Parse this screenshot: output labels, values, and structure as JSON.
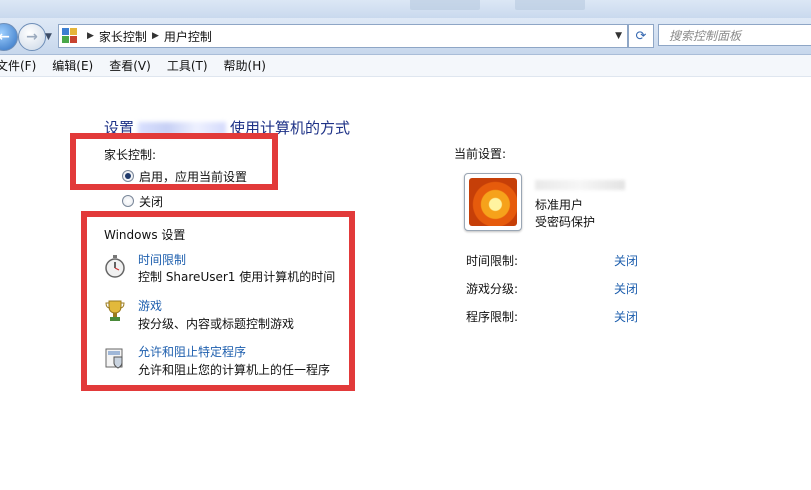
{
  "address_bar": {
    "breadcrumb": [
      "家长控制",
      "用户控制"
    ],
    "search_placeholder": "搜索控制面板"
  },
  "menu": [
    "文件(F)",
    "编辑(E)",
    "查看(V)",
    "工具(T)",
    "帮助(H)"
  ],
  "main": {
    "title_prefix": "设置",
    "title_suffix": "使用计算机的方式",
    "parental_label": "家长控制:",
    "option_on": "启用，应用当前设置",
    "option_off": "关闭",
    "windows_settings": "Windows 设置",
    "items": [
      {
        "link": "时间限制",
        "desc": "控制 ShareUser1 使用计算机的时间",
        "icon": "stopwatch-icon"
      },
      {
        "link": "游戏",
        "desc": "按分级、内容或标题控制游戏",
        "icon": "trophy-icon"
      },
      {
        "link": "允许和阻止特定程序",
        "desc": "允许和阻止您的计算机上的任一程序",
        "icon": "program-shield-icon"
      }
    ]
  },
  "current": {
    "label": "当前设置:",
    "user_type": "标准用户",
    "password": "受密码保护",
    "rows": [
      {
        "label": "时间限制:",
        "value": "关闭"
      },
      {
        "label": "游戏分级:",
        "value": "关闭"
      },
      {
        "label": "程序限制:",
        "value": "关闭"
      }
    ]
  },
  "colors": {
    "highlight_box": "#e23a3a",
    "link": "#1e5fae",
    "heading": "#1e3287"
  }
}
